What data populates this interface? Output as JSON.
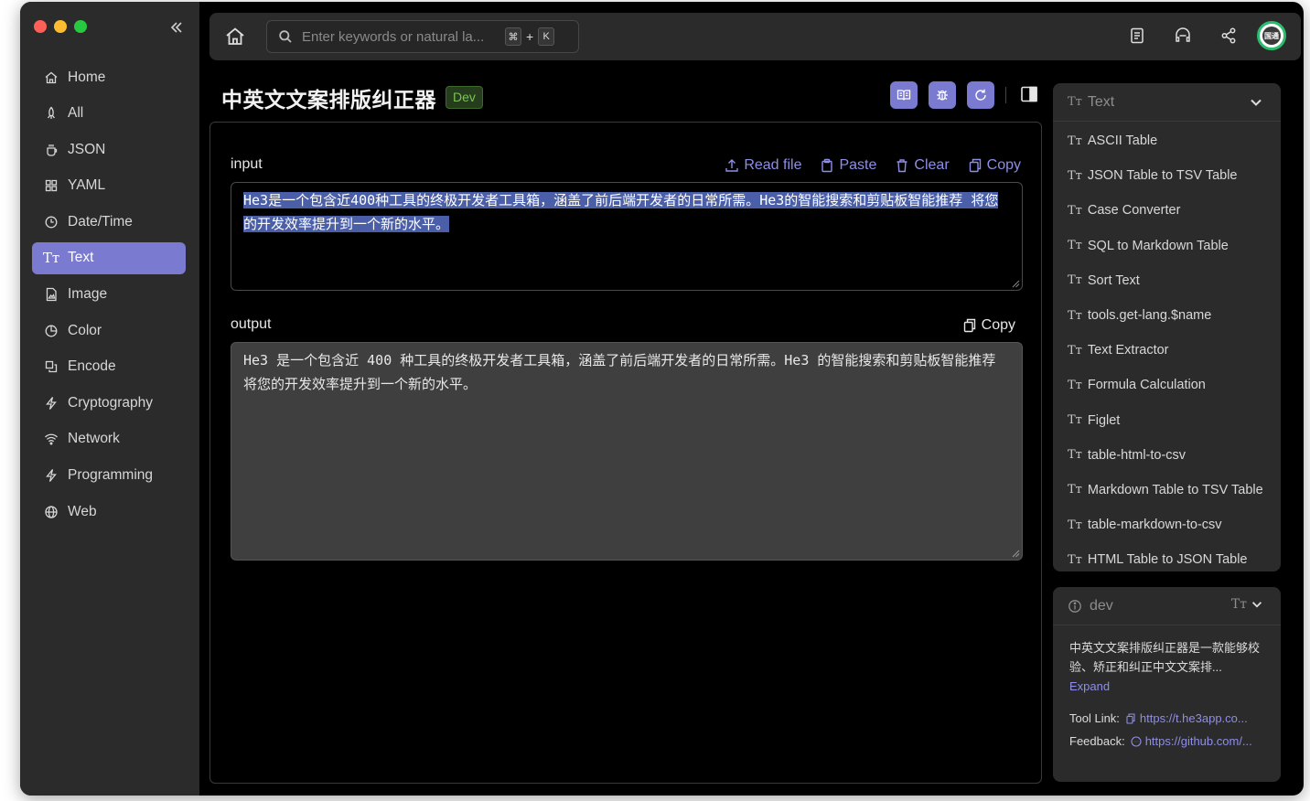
{
  "window": {
    "traffic_colors": [
      "#ff5f57",
      "#febc2e",
      "#28c840"
    ]
  },
  "sidebar": {
    "items": [
      {
        "label": "Home",
        "icon": "home-icon"
      },
      {
        "label": "All",
        "icon": "rocket-icon"
      },
      {
        "label": "JSON",
        "icon": "json-icon"
      },
      {
        "label": "YAML",
        "icon": "grid-icon"
      },
      {
        "label": "Date/Time",
        "icon": "clock-icon"
      },
      {
        "label": "Text",
        "icon": "text-icon",
        "active": true
      },
      {
        "label": "Image",
        "icon": "image-icon"
      },
      {
        "label": "Color",
        "icon": "color-icon"
      },
      {
        "label": "Encode",
        "icon": "encode-icon"
      },
      {
        "label": "Cryptography",
        "icon": "bolt-icon"
      },
      {
        "label": "Network",
        "icon": "wifi-icon"
      },
      {
        "label": "Programming",
        "icon": "bolt-icon"
      },
      {
        "label": "Web",
        "icon": "globe-icon"
      }
    ]
  },
  "topbar": {
    "search_placeholder": "Enter keywords or natural la...",
    "shortcut_mod": "⌘",
    "shortcut_plus": "+",
    "shortcut_key": "K",
    "avatar_text": "国通"
  },
  "tool": {
    "title": "中英文文案排版纠正器",
    "badge": "Dev"
  },
  "input": {
    "label": "input",
    "actions": {
      "read_file": "Read file",
      "paste": "Paste",
      "clear": "Clear",
      "copy": "Copy"
    },
    "value": "He3是一个包含近400种工具的终极开发者工具箱，涵盖了前后端开发者的日常所需。He3的智能搜索和剪贴板智能推荐 将您的开发效率提升到一个新的水平。"
  },
  "output": {
    "label": "output",
    "copy": "Copy",
    "value": "He3 是一个包含近 400 种工具的终极开发者工具箱，涵盖了前后端开发者的日常所需。He3 的智能搜索和剪贴板智能推荐 将您的开发效率提升到一个新的水平。"
  },
  "category_panel": {
    "title": "Text",
    "items": [
      "ASCII Table",
      "JSON Table to TSV Table",
      "Case Converter",
      "SQL to Markdown Table",
      "Sort Text",
      "tools.get-lang.$name",
      "Text Extractor",
      "Formula Calculation",
      "Figlet",
      "table-html-to-csv",
      "Markdown Table to TSV Table",
      "table-markdown-to-csv",
      "HTML Table to JSON Table"
    ]
  },
  "info_panel": {
    "title": "dev",
    "description": "中英文文案排版纠正器是一款能够校验、矫正和纠正中文文案排...",
    "expand": "Expand",
    "tool_link_label": "Tool Link:",
    "tool_link": "https://t.he3app.co...",
    "feedback_label": "Feedback:",
    "feedback_link": "https://github.com/..."
  },
  "colors": {
    "accent": "#7a7ad0",
    "link": "#8e8ee6",
    "badge_green": "#7cc257"
  }
}
